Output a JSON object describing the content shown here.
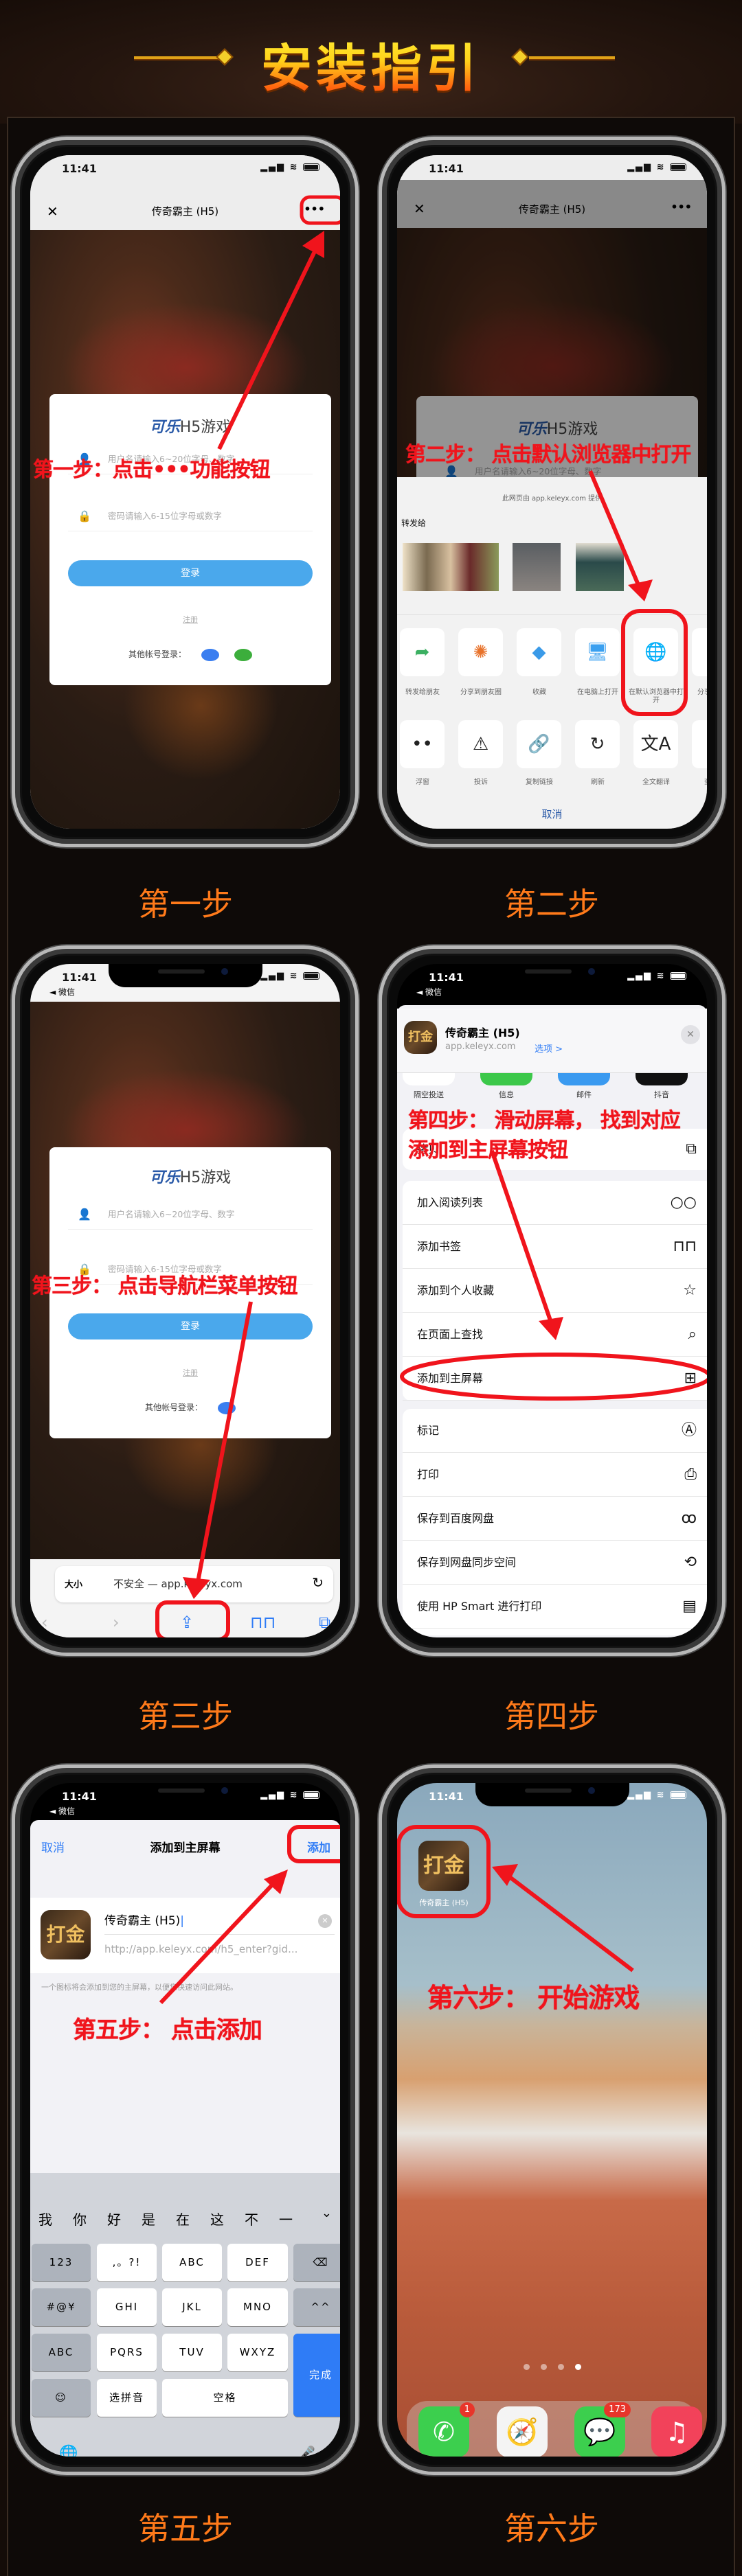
{
  "header": {
    "title": "安装指引"
  },
  "colors": {
    "accent_label": "#ff7a1a",
    "annotation_red": "#f0141c",
    "login_blue": "#4aa8ec",
    "ios_blue": "#2f7cf6"
  },
  "status": {
    "time": "11:41",
    "back_app": "◄ 微信",
    "signal_icon": "signal-icon",
    "wifi_icon": "wifi-icon",
    "battery_icon": "battery-icon"
  },
  "game": {
    "page_title": "传奇霸主 (H5)",
    "logo_brand": "可乐",
    "logo_suffix": "H5游戏",
    "username_placeholder": "用户名请输入6~20位字母、数字",
    "password_placeholder": "密码请输入6-15位字母或数字",
    "login": "登录",
    "register": "注册",
    "other_login": "其他帐号登录："
  },
  "step1": {
    "label": "第一步",
    "annotation": "第一步：点击•••功能按钮",
    "close": "✕",
    "more": "•••"
  },
  "step2": {
    "label": "第二步",
    "annotation": "第二步： 点击默认浏览器中打开",
    "provided_by": "此网页由 app.keleyx.com 提供",
    "forward_to": "转发给",
    "row1": [
      {
        "label": "转发给朋友",
        "icon": "forward-icon",
        "glyph": "➦",
        "color": "#3cb062"
      },
      {
        "label": "分享到朋友圈",
        "icon": "moments-icon",
        "glyph": "✺",
        "color": "#e8722a"
      },
      {
        "label": "收藏",
        "icon": "favorite-cube-icon",
        "glyph": "◆",
        "color": "#3a9ae8"
      },
      {
        "label": "在电脑上打开",
        "icon": "computer-icon",
        "glyph": "🖥",
        "color": "#3aa0f0"
      },
      {
        "label": "在默认浏览器中打开",
        "icon": "browser-globe-icon",
        "glyph": "🌐",
        "color": "#2f6ee0"
      },
      {
        "label": "分享到手机",
        "icon": "qq-icon",
        "glyph": "🐧",
        "color": "#222"
      }
    ],
    "row2": [
      {
        "label": "浮窗",
        "icon": "float-window-icon",
        "glyph": "••",
        "color": "#222"
      },
      {
        "label": "投诉",
        "icon": "warning-icon",
        "glyph": "⚠",
        "color": "#222"
      },
      {
        "label": "复制链接",
        "icon": "link-icon",
        "glyph": "🔗",
        "color": "#222"
      },
      {
        "label": "刷新",
        "icon": "refresh-icon",
        "glyph": "↻",
        "color": "#222"
      },
      {
        "label": "全文翻译",
        "icon": "translate-icon",
        "glyph": "文A",
        "color": "#222"
      },
      {
        "label": "查找页",
        "icon": "find-page-icon",
        "glyph": "⌕",
        "color": "#222"
      }
    ],
    "cancel": "取消"
  },
  "step3": {
    "label": "第三步",
    "annotation": "第三步： 点击导航栏菜单按钮",
    "text_size": "大小",
    "url": "不安全 — app.keleyx.com",
    "toolbar": [
      {
        "icon": "back-chevron-icon",
        "glyph": "‹"
      },
      {
        "icon": "forward-chevron-icon",
        "glyph": "›"
      },
      {
        "icon": "share-icon",
        "glyph": "⇪"
      },
      {
        "icon": "bookmarks-icon",
        "glyph": "⊓⊓"
      },
      {
        "icon": "tabs-icon",
        "glyph": "⧉"
      }
    ]
  },
  "step4": {
    "label": "第四步",
    "annotation_line1": "第四步： 滑动屏幕， 找到对应",
    "annotation_line2": "添加到主屏幕按钮",
    "app_title": "传奇霸主 (H5)",
    "domain": "app.keleyx.com",
    "options": "选项 >",
    "share_targets": [
      "隔空投送",
      "信息",
      "邮件",
      "抖音"
    ],
    "copy": {
      "label": "拷贝",
      "icon": "copy-icon",
      "glyph": "⧉"
    },
    "group1": [
      {
        "label": "加入阅读列表",
        "icon": "glasses-icon",
        "glyph": "○○"
      },
      {
        "label": "添加书签",
        "icon": "book-icon",
        "glyph": "⊓⊓"
      },
      {
        "label": "添加到个人收藏",
        "icon": "star-icon",
        "glyph": "☆"
      },
      {
        "label": "在页面上查找",
        "icon": "find-icon",
        "glyph": "⌕"
      },
      {
        "label": "添加到主屏幕",
        "icon": "add-square-icon",
        "glyph": "⊞"
      }
    ],
    "group2": [
      {
        "label": "标记",
        "icon": "markup-icon",
        "glyph": "Ⓐ"
      },
      {
        "label": "打印",
        "icon": "printer-icon",
        "glyph": "⎙"
      },
      {
        "label": "保存到百度网盘",
        "icon": "baidu-pan-icon",
        "glyph": "ꝏ"
      },
      {
        "label": "保存到网盘同步空间",
        "icon": "sync-space-icon",
        "glyph": "⟲"
      },
      {
        "label": "使用 HP Smart 进行打印",
        "icon": "hp-smart-icon",
        "glyph": "▤"
      }
    ]
  },
  "step5": {
    "label": "第五步",
    "annotation": "第五步： 点击添加",
    "cancel": "取消",
    "title": "添加到主屏幕",
    "add": "添加",
    "name": "传奇霸主 (H5)",
    "url": "http://app.keleyx.com/h5_enter?gid...",
    "note": "一个图标将会添加到您的主屏幕，以便您快速访问此网站。",
    "candidates": [
      "我",
      "你",
      "好",
      "是",
      "在",
      "这",
      "不",
      "一"
    ],
    "keys": [
      [
        "123",
        ",。?!",
        "ABC",
        "DEF",
        "⌫"
      ],
      [
        "#@¥",
        "GHI",
        "JKL",
        "MNO",
        "^^"
      ],
      [
        "ABC",
        "PQRS",
        "TUV",
        "WXYZ",
        "完成"
      ],
      [
        "☺",
        "选拼音",
        "空格"
      ]
    ],
    "globe": "🌐",
    "mic": "🎤",
    "app_icon_text": "打金"
  },
  "step6": {
    "label": "第六步",
    "annotation": "第六步： 开始游戏",
    "app_label": "传奇霸主 (H5)",
    "app_icon_text": "打金",
    "page_dots": 4,
    "active_page": 4,
    "dock": [
      {
        "icon": "phone-icon",
        "glyph": "✆",
        "badge": "1",
        "color": "#3ccf4e"
      },
      {
        "icon": "safari-icon",
        "glyph": "🧭",
        "badge": "",
        "color": "#f4f4f4"
      },
      {
        "icon": "messages-icon",
        "glyph": "💬",
        "badge": "173",
        "color": "#3ccf4e"
      },
      {
        "icon": "music-icon",
        "glyph": "♫",
        "badge": "",
        "color": "#f2425a"
      }
    ]
  }
}
